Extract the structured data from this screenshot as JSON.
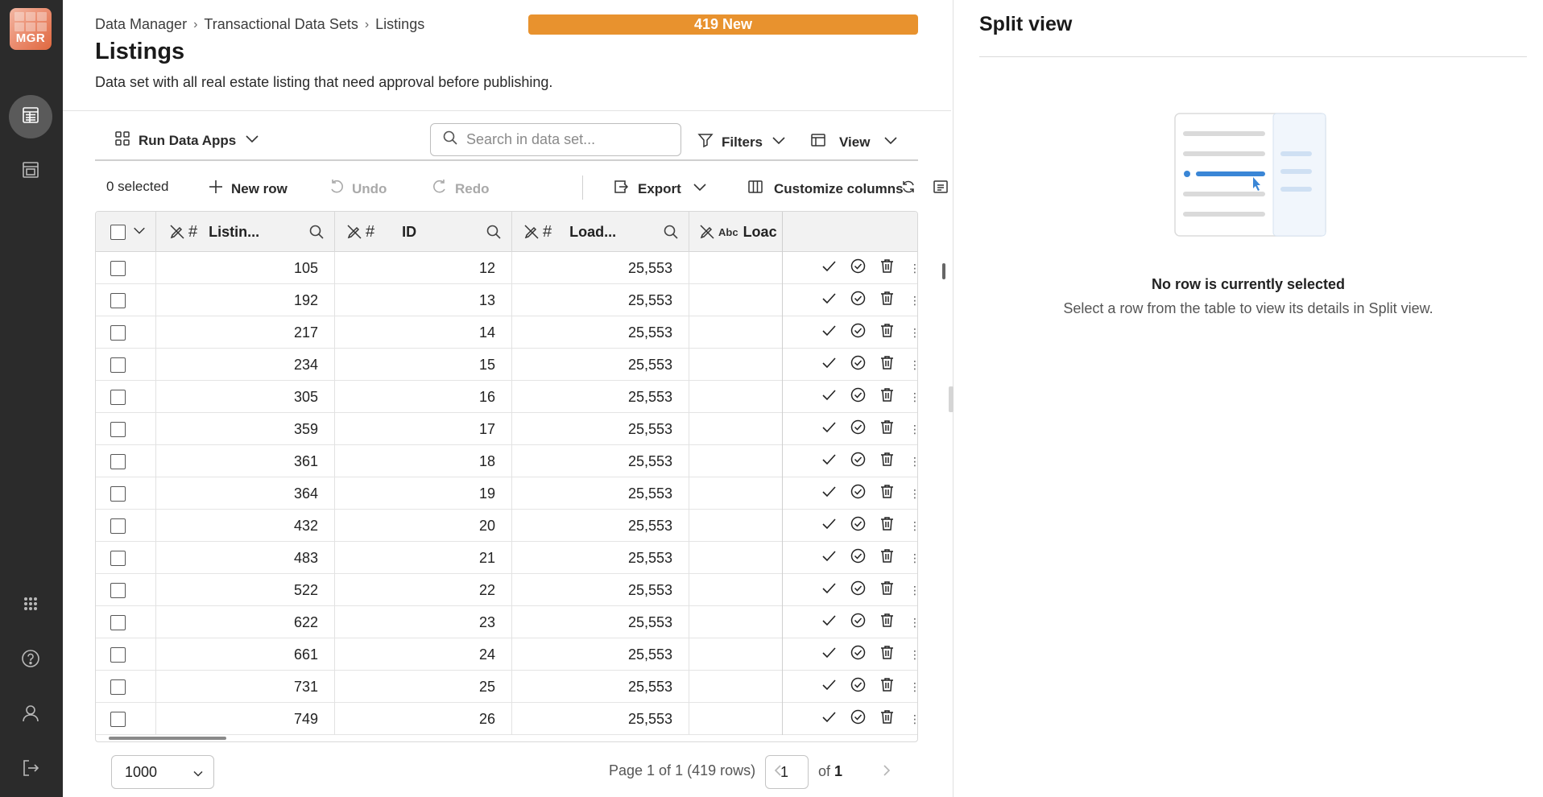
{
  "app": {
    "logo_text": "MGR"
  },
  "rail": {
    "icons": [
      "data-sets-icon",
      "reports-icon",
      "apps-grid-icon",
      "help-icon",
      "user-icon",
      "logout-icon"
    ]
  },
  "breadcrumb": [
    "Data Manager",
    "Transactional Data Sets",
    "Listings"
  ],
  "badge": "419 New",
  "page": {
    "title": "Listings",
    "description": "Data set with all real estate listing that need approval before publishing."
  },
  "toolbar": {
    "run_apps": "Run Data Apps",
    "search_placeholder": "Search in data set...",
    "filters": "Filters",
    "view": "View"
  },
  "actions": {
    "selected": "0 selected",
    "new_row": "New row",
    "undo": "Undo",
    "redo": "Redo",
    "export": "Export",
    "customize": "Customize columns"
  },
  "table": {
    "columns": [
      {
        "label": "Listin...",
        "type": "#"
      },
      {
        "label": "ID",
        "type": "#"
      },
      {
        "label": "Load...",
        "type": "#"
      },
      {
        "label": "Loac",
        "type": "Abc"
      }
    ],
    "rows": [
      [
        "105",
        "12",
        "25,553"
      ],
      [
        "192",
        "13",
        "25,553"
      ],
      [
        "217",
        "14",
        "25,553"
      ],
      [
        "234",
        "15",
        "25,553"
      ],
      [
        "305",
        "16",
        "25,553"
      ],
      [
        "359",
        "17",
        "25,553"
      ],
      [
        "361",
        "18",
        "25,553"
      ],
      [
        "364",
        "19",
        "25,553"
      ],
      [
        "432",
        "20",
        "25,553"
      ],
      [
        "483",
        "21",
        "25,553"
      ],
      [
        "522",
        "22",
        "25,553"
      ],
      [
        "622",
        "23",
        "25,553"
      ],
      [
        "661",
        "24",
        "25,553"
      ],
      [
        "731",
        "25",
        "25,553"
      ],
      [
        "749",
        "26",
        "25,553"
      ]
    ]
  },
  "pagination": {
    "page_size": "1000",
    "summary": "Page 1 of 1 (419 rows)",
    "current_page": "1",
    "of_label": "of",
    "total_pages": "1"
  },
  "split": {
    "title": "Split view",
    "empty_title": "No row is currently selected",
    "empty_sub": "Select a row from the table to view its details in Split view."
  },
  "colors": {
    "rail_bg": "#2b2b2b",
    "badge": "#e8922e",
    "accent_blue": "#3a86d6"
  }
}
